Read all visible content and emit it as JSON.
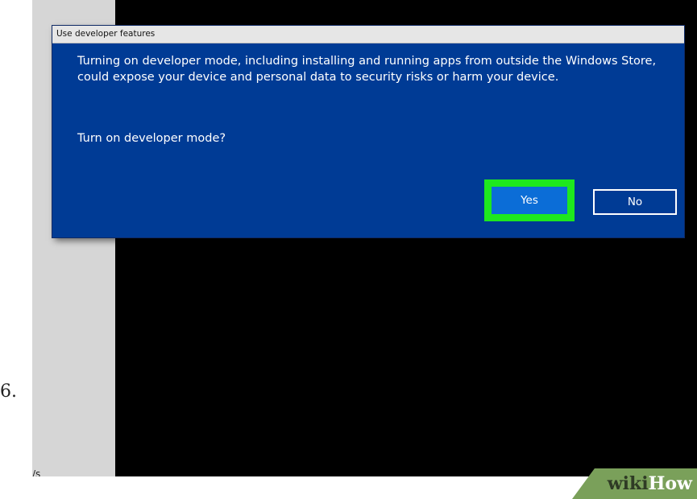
{
  "step": {
    "number": "6."
  },
  "background": {
    "left_pane_text": "/s"
  },
  "dialog": {
    "title": "Use developer features",
    "message": "Turning on developer mode, including installing and running apps from outside the Windows Store, could expose your device and personal data to security risks or harm your device.",
    "question": "Turn on developer mode?",
    "yes_label": "Yes",
    "no_label": "No",
    "colors": {
      "dialog_bg": "#003b95",
      "yes_button": "#0b6dd7",
      "highlight": "#1ee81e",
      "titlebar": "#e6e6e6"
    }
  },
  "watermark": {
    "wiki": "wiki",
    "how": "How",
    "color": "#7aa05a"
  }
}
